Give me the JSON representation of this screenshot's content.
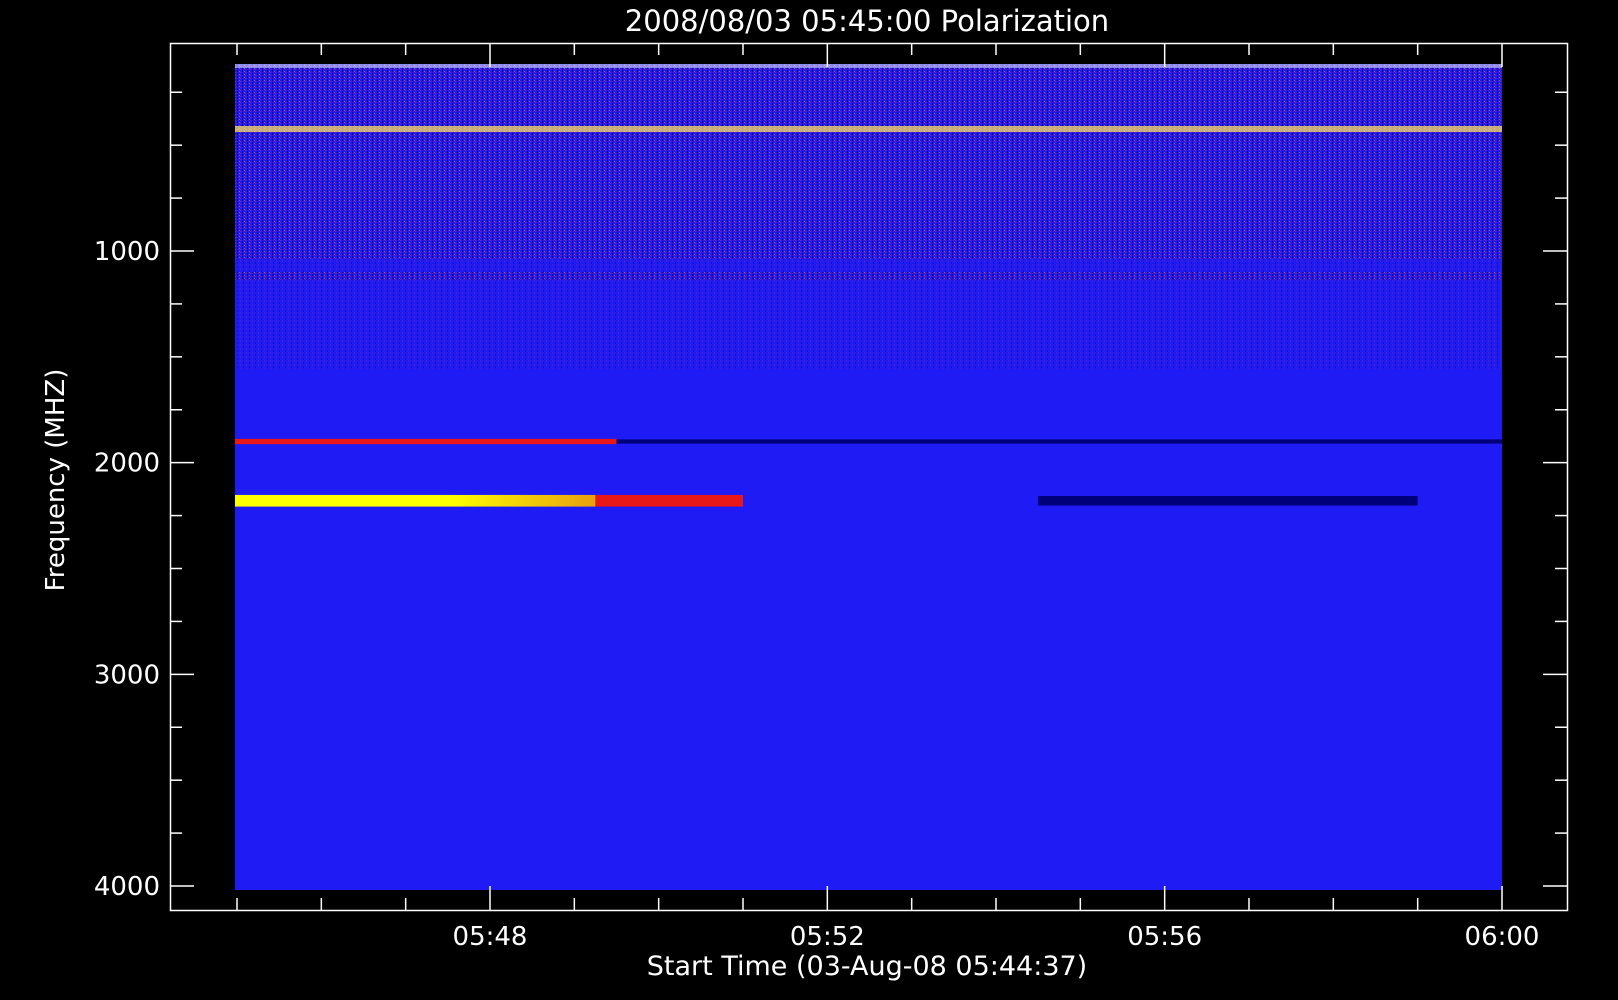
{
  "chart_data": {
    "type": "heatmap",
    "title": "2008/08/03 05:45:00 Polarization",
    "xlabel": "Start Time (03-Aug-08 05:44:37)",
    "ylabel": "Frequency (MHZ)",
    "x_tick_labels": [
      "05:48",
      "05:52",
      "05:56",
      "06:00"
    ],
    "y_tick_labels": [
      "1000",
      "2000",
      "3000",
      "4000"
    ],
    "y_ticks": [
      1000,
      2000,
      3000,
      4000
    ],
    "ylim": [
      4000,
      120
    ],
    "x_time_range": [
      "05:44:37",
      "06:00:04"
    ],
    "y_inverted": true,
    "colors": {
      "background": "#000000",
      "foreground": "#ffffff",
      "base": "#1f1bf5",
      "red": "#e81818",
      "yellow": "#ffff00",
      "dark": "#00007a"
    },
    "bands": [
      {
        "freq_center": 1900,
        "freq_width": 25,
        "t_start": "05:44:37",
        "t_end": "05:49:30",
        "value": "red"
      },
      {
        "freq_center": 1900,
        "freq_width": 20,
        "t_start": "05:49:30",
        "t_end": "06:00:00",
        "value": "dark"
      },
      {
        "freq_center": 2180,
        "freq_width": 55,
        "t_start": "05:44:37",
        "t_end": "05:49:15",
        "value": "yellow"
      },
      {
        "freq_center": 2180,
        "freq_width": 55,
        "t_start": "05:49:15",
        "t_end": "05:51:00",
        "value": "red"
      },
      {
        "freq_center": 2180,
        "freq_width": 45,
        "t_start": "05:54:30",
        "t_end": "05:59:00",
        "value": "dark"
      }
    ]
  }
}
